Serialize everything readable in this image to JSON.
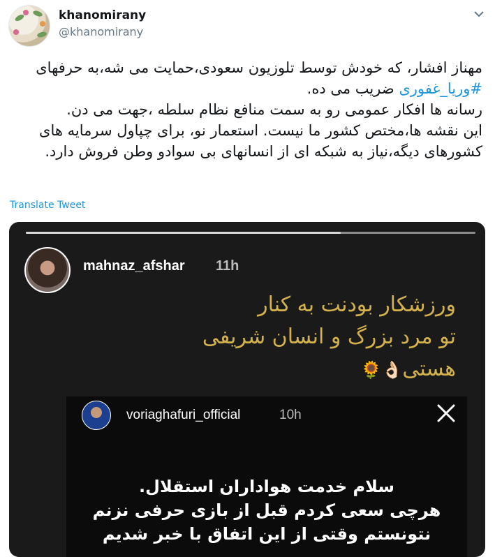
{
  "author": {
    "display_name": "khanomirany",
    "handle": "@khanomirany"
  },
  "tweet": {
    "lines": [
      "مهناز افشار، که خودش توسط تلوزیون سعودی،حمایت می شه،به حرفهای",
      "ضریب می ده.",
      "رسانه ها افکار عمومی  رو به سمت منافع نظام سلطه ،جهت می دن.",
      "این نقشه ها،مختص کشور ما نیست. استعمار نو، برای چپاول سرمایه های",
      "کشورهای دیگه،نیاز به شبکه ای از انسانهای بی سوادو وطن فروش دارد."
    ],
    "hashtag": "#وریا_غفوری",
    "translate_label": "Translate Tweet"
  },
  "story": {
    "username": "mahnaz_afshar",
    "time": "11h",
    "progress": 0.7,
    "caption_lines": [
      "ورزشکار بودنت به کنار",
      "تو مرد بزرگ و انسان شریفی",
      "هستی"
    ],
    "emojis": [
      "👌🏻",
      "🌻"
    ],
    "shared_post": {
      "username": "voriaghafuri_official",
      "time": "10h",
      "text_lines": [
        "سلام خدمت هواداران استقلال.",
        "هرچی سعی کردم قبل از بازی حرفی نزنم",
        "نتونستم وقتی از این اتفاق با خبر شدیم"
      ]
    }
  }
}
